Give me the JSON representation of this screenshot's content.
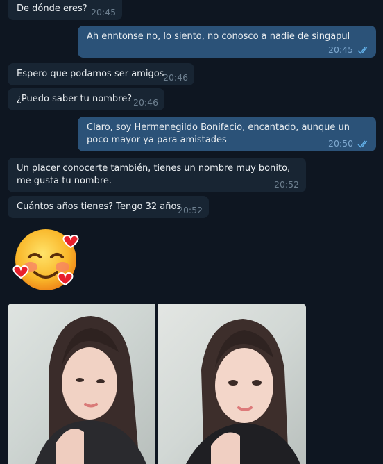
{
  "messages": [
    {
      "text": "De dónde eres?",
      "time": "20:45",
      "direction": "incoming"
    },
    {
      "text": "Ah enntonse no, lo siento, no conosco a nadie de singapul",
      "time": "20:45",
      "direction": "outgoing",
      "status": "read"
    },
    {
      "text": "Espero que podamos ser amigos",
      "time": "20:46",
      "direction": "incoming"
    },
    {
      "text": "¿Puedo saber tu nombre?",
      "time": "20:46",
      "direction": "incoming"
    },
    {
      "text": "Claro, soy Hermenegildo Bonifacio, encantado, aunque un poco mayor ya para amistades",
      "time": "20:50",
      "direction": "outgoing",
      "status": "read"
    },
    {
      "text": "Un placer conocerte también, tienes un nombre muy bonito, me gusta tu nombre.",
      "time": "20:52",
      "direction": "incoming"
    },
    {
      "text": "Cuántos años tienes? Tengo 32 años",
      "time": "20:52",
      "direction": "incoming"
    }
  ],
  "sticker": {
    "icon": "smiling-face-with-hearts-icon"
  },
  "photos": [
    {
      "icon": "photo-woman-selfie-1"
    },
    {
      "icon": "photo-woman-selfie-2"
    }
  ],
  "colors": {
    "background": "#0e1621",
    "incoming_bubble": "#182533",
    "outgoing_bubble": "#2b5278",
    "read_check": "#62b0e8"
  }
}
